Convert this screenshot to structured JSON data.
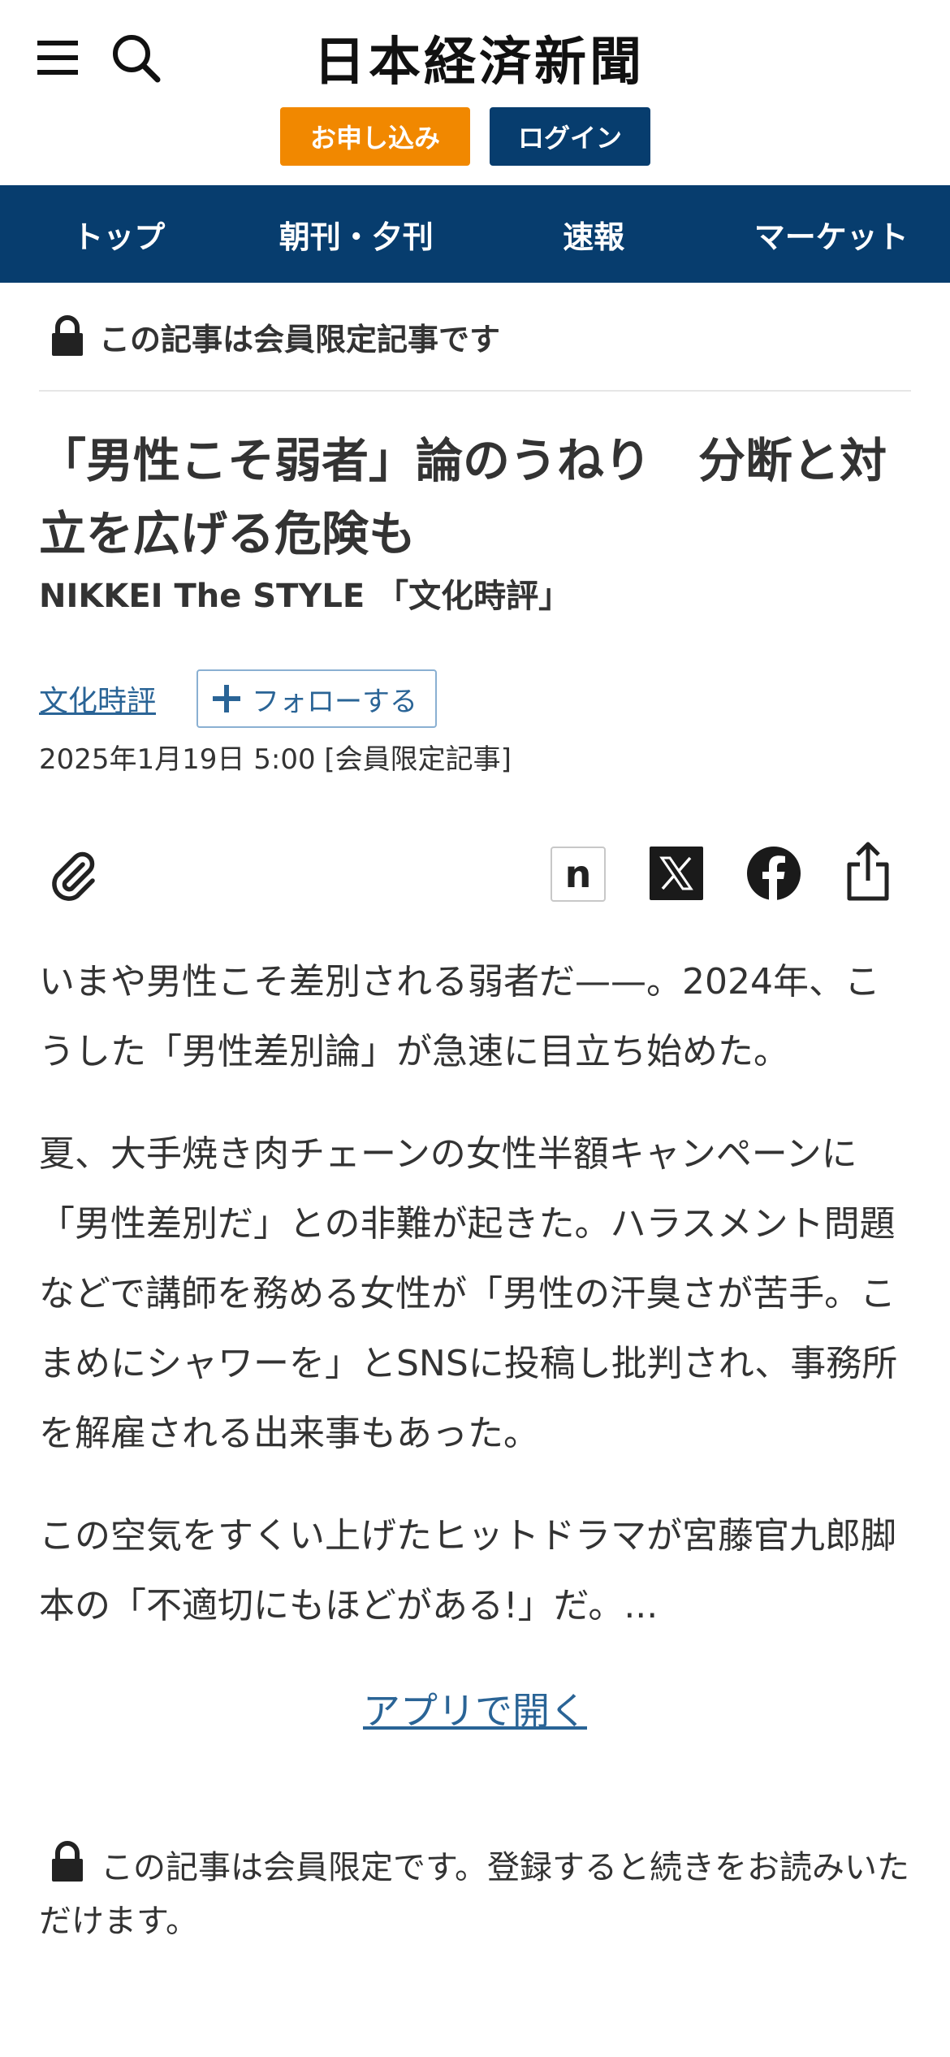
{
  "header": {
    "logo_text": "日本経済新聞",
    "apply_label": "お申し込み",
    "login_label": "ログイン"
  },
  "nav": {
    "items": [
      {
        "label": "トップ"
      },
      {
        "label": "朝刊・夕刊"
      },
      {
        "label": "速報"
      },
      {
        "label": "マーケット"
      }
    ]
  },
  "article": {
    "member_notice": "この記事は会員限定記事です",
    "title": "「男性こそ弱者」論のうねり　分断と対立を広げる危険も",
    "subtitle": "NIKKEI The STYLE 「文化時評」",
    "topic": "文化時評",
    "follow_label": "フォローする",
    "date": "2025年1月19日 5:00 [会員限定記事]",
    "paragraphs": [
      "いまや男性こそ差別される弱者だ——。2024年、こうした「男性差別論」が急速に目立ち始めた。",
      "夏、大手焼き肉チェーンの女性半額キャンペーンに「男性差別だ」との非難が起きた。ハラスメント問題などで講師を務める女性が「男性の汗臭さが苦手。こまめにシャワーを」とSNSに投稿し批判され、事務所を解雇される出来事もあった。",
      "この空気をすくい上げたヒットドラマが宮藤官九郎脚本の「不適切にもほどがある!」だ。..."
    ],
    "open_app_label": "アプリで開く",
    "bottom_notice": "この記事は会員限定です。登録すると続きをお読みいただけます。"
  },
  "share": {
    "n_label": "n",
    "icons": [
      "paperclip-icon",
      "nikkei-n-icon",
      "x-icon",
      "facebook-icon",
      "share-icon"
    ]
  },
  "colors": {
    "navy": "#073d6e",
    "orange": "#f18800",
    "link": "#2a6496",
    "text": "#333333"
  }
}
